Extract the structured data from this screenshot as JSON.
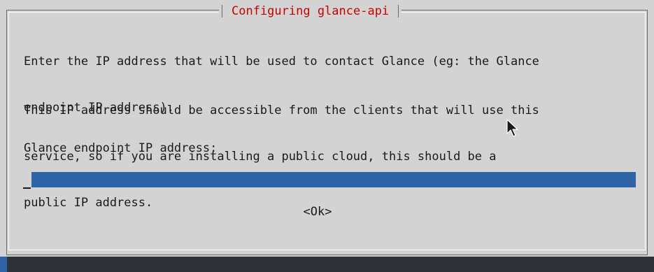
{
  "dialog": {
    "title": "Configuring glance-api",
    "paragraph_1_line_1": "Enter the IP address that will be used to contact Glance (eg: the Glance",
    "paragraph_1_line_2": "endpoint IP address).",
    "paragraph_2_line_1": "This IP address should be accessible from the clients that will use this",
    "paragraph_2_line_2": "service, so if you are installing a public cloud, this should be a",
    "paragraph_2_line_3": "public IP address.",
    "field_label": "Glance endpoint IP address:",
    "field_value": "",
    "ok_label": "<Ok>"
  },
  "colors": {
    "background": "#d3d3d3",
    "title": "#cc0000",
    "input_fill": "#2e64a6",
    "taskbar": "#2f3236"
  },
  "icons": {
    "pointer": "mouse-pointer-icon"
  }
}
